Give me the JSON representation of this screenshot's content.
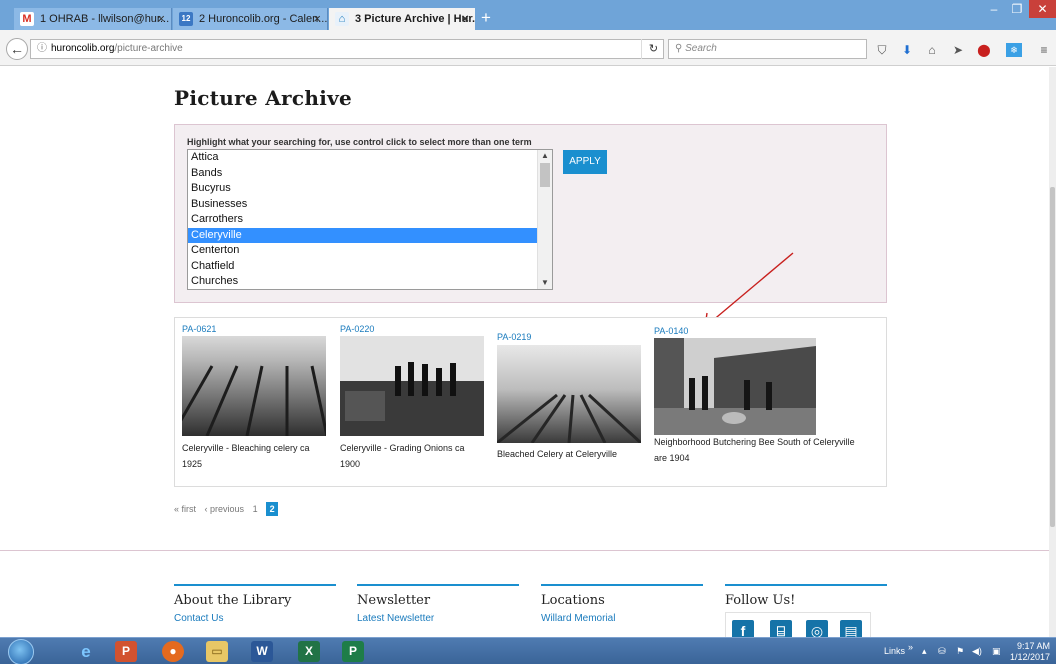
{
  "browser": {
    "tabs": [
      {
        "label": "1 OHRAB - llwilson@hur...",
        "icon": "gmail-icon",
        "active": false
      },
      {
        "label": "2 Huroncolib.org - Calen...",
        "icon": "calendar-icon",
        "active": false
      },
      {
        "label": "3 Picture Archive | Hur...",
        "icon": "library-icon",
        "active": true
      }
    ],
    "new_tab": "+",
    "close_glyph": "×",
    "url": {
      "host": "huroncolib.org",
      "path": "/picture-archive"
    },
    "search_placeholder": "Search"
  },
  "page": {
    "title": "Picture Archive",
    "search_label": "Highlight what your searching for, use control click to select more than one term",
    "list_options": [
      "Attica",
      "Bands",
      "Bucyrus",
      "Businesses",
      "Carrothers",
      "Celeryville",
      "Centerton",
      "Chatfield",
      "Churches"
    ],
    "selected_option": "Celeryville",
    "apply_label": "APPLY",
    "results": [
      {
        "code": "PA-0621",
        "caption_line1": "Celeryville - Bleaching celery ca",
        "caption_line2": "1925"
      },
      {
        "code": "PA-0220",
        "caption_line1": "Celeryville - Grading Onions ca",
        "caption_line2": "1900"
      },
      {
        "code": "PA-0219",
        "caption_line1": "Bleached Celery at Celeryville",
        "caption_line2": ""
      },
      {
        "code": "PA-0140",
        "caption_line1": "Neighborhood Butchering Bee South of Celeryville",
        "caption_line2": "are 1904"
      }
    ],
    "pager": {
      "first": "« first",
      "previous": "‹ previous",
      "page1": "1",
      "page2": "2"
    }
  },
  "footer": {
    "columns": [
      {
        "heading": "About the Library",
        "link": "Contact Us"
      },
      {
        "heading": "Newsletter",
        "link": "Latest Newsletter"
      },
      {
        "heading": "Locations",
        "link": "Willard Memorial"
      },
      {
        "heading": "Follow Us!",
        "link": ""
      }
    ]
  },
  "taskbar": {
    "links_label": "Links",
    "time": "9:17 AM",
    "date": "1/12/2017"
  },
  "colors": {
    "accent_blue": "#1a8fcf",
    "link_blue": "#1a7bbd",
    "selection_blue": "#3390ff",
    "annotation_red": "#c8201e"
  }
}
